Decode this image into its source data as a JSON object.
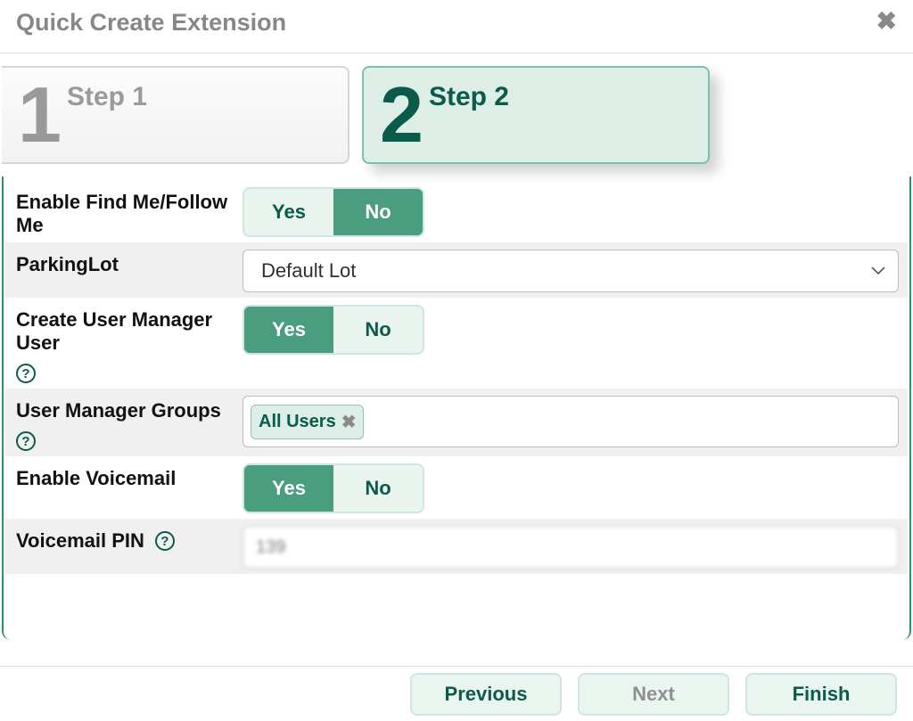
{
  "modal": {
    "title": "Quick Create Extension"
  },
  "steps": [
    {
      "num": "1",
      "label": "Step 1",
      "active": false
    },
    {
      "num": "2",
      "label": "Step 2",
      "active": true
    }
  ],
  "toggles": {
    "yes": "Yes",
    "no": "No"
  },
  "fields": {
    "findme": {
      "label": "Enable Find Me/Follow Me",
      "value": "No"
    },
    "parkinglot": {
      "label": "ParkingLot",
      "value": "Default Lot"
    },
    "create_um_user": {
      "label": "Create User Manager User",
      "value": "Yes"
    },
    "um_groups": {
      "label": "User Manager Groups",
      "tags": [
        "All Users"
      ]
    },
    "enable_vm": {
      "label": "Enable Voicemail",
      "value": "Yes"
    },
    "vm_pin": {
      "label": "Voicemail PIN",
      "value": "139"
    }
  },
  "footer": {
    "previous": "Previous",
    "next": "Next",
    "finish": "Finish"
  }
}
